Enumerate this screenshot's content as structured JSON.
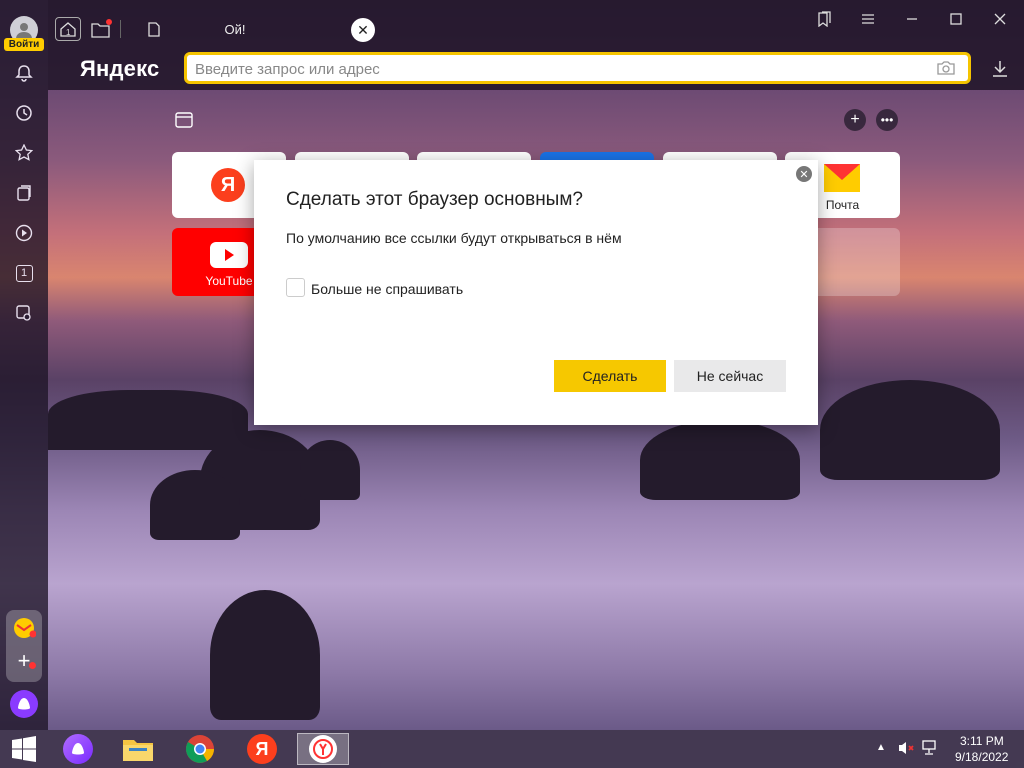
{
  "browser": {
    "logo": "Яндекс",
    "login_label": "Войти",
    "tab_title": "Ой!",
    "address_placeholder": "Введите запрос или адрес",
    "brand_color": "#ffcc00"
  },
  "sidebar": {
    "icons": [
      "bell-icon",
      "history-icon",
      "bookmarks-star-icon",
      "collections-icon",
      "video-play-icon",
      "tab-counter-icon",
      "screenshot-icon"
    ],
    "tab_counter": "1"
  },
  "dashboard": {
    "tiles": [
      {
        "name": "tile-yandex",
        "label": ""
      },
      {
        "name": "tile-2",
        "label": ""
      },
      {
        "name": "tile-3",
        "label": ""
      },
      {
        "name": "tile-4",
        "label": ""
      },
      {
        "name": "tile-5",
        "label": ""
      },
      {
        "name": "tile-mail",
        "label": "Почта"
      },
      {
        "name": "tile-youtube",
        "label": "YouTube"
      }
    ]
  },
  "dialog": {
    "title": "Сделать этот браузер основным?",
    "text": "По умолчанию все ссылки будут открываться в нём",
    "checkbox_label": "Больше не спрашивать",
    "primary_button": "Сделать",
    "secondary_button": "Не сейчас"
  },
  "taskbar": {
    "time": "3:11 PM",
    "date": "9/18/2022",
    "apps": [
      "windows-start-icon",
      "alice-icon",
      "file-explorer-icon",
      "chrome-icon",
      "yandex-icon",
      "yandex-browser-icon"
    ]
  }
}
